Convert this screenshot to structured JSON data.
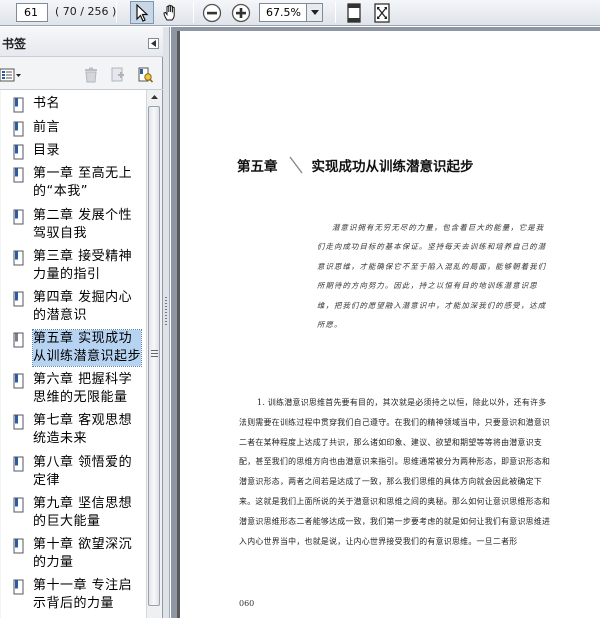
{
  "toolbar": {
    "page_input_value": "61",
    "page_count": "( 70 / 256 )",
    "zoom_value": "67.5%"
  },
  "panel": {
    "title": "书签"
  },
  "bookmarks": [
    {
      "label": "书名"
    },
    {
      "label": "前言"
    },
    {
      "label": "目录"
    },
    {
      "label": "第一章 至高无上的“本我”"
    },
    {
      "label": "第二章 发展个性驾驭自我"
    },
    {
      "label": "第三章 接受精神力量的指引"
    },
    {
      "label": "第四章 发掘内心的潜意识"
    },
    {
      "label": "第五章 实现成功从训练潜意识起步",
      "selected": true
    },
    {
      "label": "第六章 把握科学思维的无限能量"
    },
    {
      "label": "第七章 客观思想统造未来"
    },
    {
      "label": "第八章 领悟爱的定律"
    },
    {
      "label": "第九章 坚信思想的巨大能量"
    },
    {
      "label": "第十章 欲望深沉的力量"
    },
    {
      "label": "第十一章 专注启示背后的力量"
    }
  ],
  "document": {
    "chapter_number": "第五章",
    "chapter_title": "实现成功从训练潜意识起步",
    "intro": "潜意识拥有无穷无尽的力量，包含着巨大的能量，它是我们走向成功目标的基本保证。坚持每天去训练和培养自己的潜意识思维，才能确保它不至于陷入混乱的局面，能够朝着我们所期待的方向努力。因此，持之以恒有目的地训练潜意识思维，把我们的愿望融入潜意识中，才能加深我们的感受，达成所愿。",
    "body": "1. 训练潜意识思维首先要有目的，其次就是必须持之以恒，除此以外，还有许多法则需要在训练过程中贯穿我们自己遵守。在我们的精神领域当中，只要意识和潜意识二者在某种程度上达成了共识，那么诸如印象、建议、欲望和期望等等将由潜意识支配，甚至我们的思维方向也由潜意识来指引。思维通常被分为两种形态，即意识形态和潜意识形态，两者之间若是达成了一致，那么我们思维的具体方向就会因此被确定下来。这就是我们上面所说的关于潜意识和思维之间的奥秘。那么如何让意识思维形态和潜意识思维形态二者能够达成一致，我们第一步要考虑的就是如何让我们有意识思维进入内心世界当中，也就是说，让内心世界接受我们的有意识思维。一旦二者形",
    "page_number": "060"
  }
}
